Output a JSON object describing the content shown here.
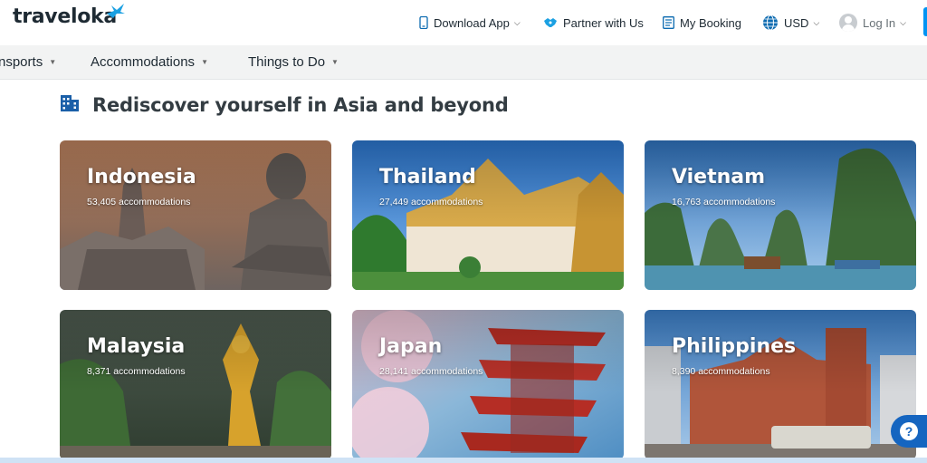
{
  "brand": {
    "name": "traveloka",
    "accent": "#0194f3"
  },
  "topnav": {
    "download_app": "Download App",
    "partner": "Partner with Us",
    "my_booking": "My Booking",
    "currency": "USD",
    "login": "Log In"
  },
  "subnav": {
    "items": [
      {
        "label": "nsports"
      },
      {
        "label": "Accommodations"
      },
      {
        "label": "Things to Do"
      }
    ]
  },
  "section": {
    "title": "Rediscover yourself in Asia and beyond",
    "icon": "building-icon"
  },
  "destinations": [
    {
      "name": "Indonesia",
      "count": "53,405 accommodations"
    },
    {
      "name": "Thailand",
      "count": "27,449 accommodations"
    },
    {
      "name": "Vietnam",
      "count": "16,763 accommodations"
    },
    {
      "name": "Malaysia",
      "count": "8,371 accommodations"
    },
    {
      "name": "Japan",
      "count": "28,141 accommodations"
    },
    {
      "name": "Philippines",
      "count": "8,390 accommodations"
    }
  ],
  "help": {
    "label": "?"
  }
}
